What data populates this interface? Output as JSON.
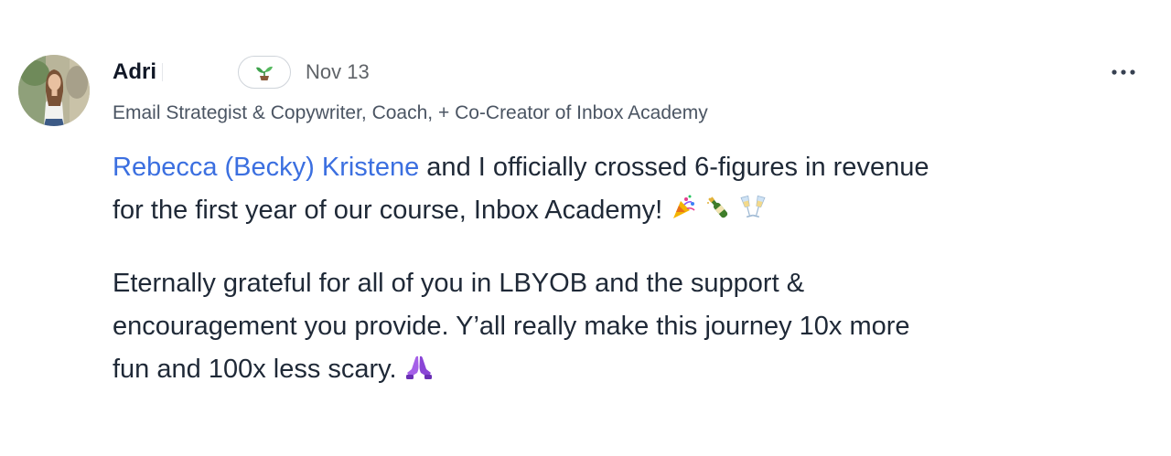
{
  "author": {
    "name": "Adri",
    "title": "Email Strategist & Copywriter, Coach, + Co-Creator of Inbox Academy",
    "avatar_icon": "profile-photo",
    "level_badge_icon": "sprout-icon"
  },
  "post": {
    "date": "Nov 13",
    "mention": "Rebecca (Becky) Kristene",
    "paragraph1_line1_rest": " and I officially crossed 6-figures in revenue",
    "paragraph1_line2": "for the first year of our course, Inbox Academy!",
    "paragraph2_line1": "Eternally grateful for all of you in LBYOB and the support &",
    "paragraph2_line2": "encouragement you provide. Y’all really make this journey 10x more",
    "paragraph2_line3": "fun and 100x less scary.",
    "emojis": [
      "party-popper",
      "champagne-bottle",
      "clinking-glasses",
      "folded-hands"
    ]
  },
  "colors": {
    "mention": "#3b6fe0",
    "text": "#1f2937",
    "muted": "#5f6368"
  }
}
